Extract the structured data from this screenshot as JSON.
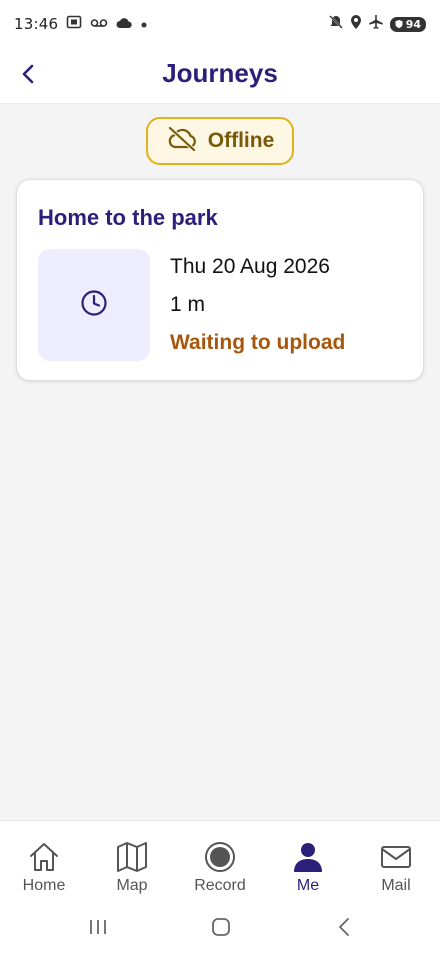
{
  "status_bar": {
    "time": "13:46",
    "battery": "94",
    "icons": [
      "screenshot-icon",
      "voicemail-icon",
      "cloud-icon",
      "dot-icon",
      "mute-icon",
      "location-icon",
      "airplane-icon",
      "battery-icon"
    ]
  },
  "header": {
    "title": "Journeys",
    "back_icon": "chevron-left-icon"
  },
  "offline_badge": {
    "label": "Offline",
    "icon": "cloud-off-icon"
  },
  "journeys": [
    {
      "title": "Home to the park",
      "date": "Thu 20 Aug 2026",
      "duration": "1 m",
      "status": "Waiting to upload",
      "icon": "clock-icon"
    }
  ],
  "bottom_nav": {
    "items": [
      {
        "label": "Home",
        "icon": "home-icon",
        "active": false
      },
      {
        "label": "Map",
        "icon": "map-icon",
        "active": false
      },
      {
        "label": "Record",
        "icon": "record-icon",
        "active": false
      },
      {
        "label": "Me",
        "icon": "person-icon",
        "active": true
      },
      {
        "label": "Mail",
        "icon": "mail-icon",
        "active": false
      }
    ]
  },
  "colors": {
    "primary": "#2b1f7a",
    "offline_border": "#e3b21b",
    "offline_text": "#7a5a07",
    "pending_status": "#a8560c",
    "thumb_bg": "#eeecff",
    "page_bg": "#f4f4f4"
  }
}
